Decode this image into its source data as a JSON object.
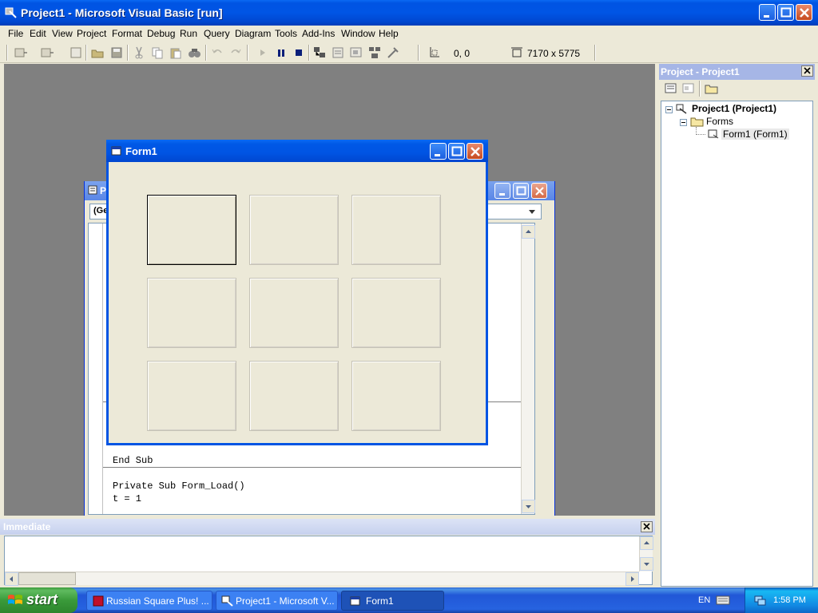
{
  "window": {
    "title": "Project1 - Microsoft Visual Basic [run]"
  },
  "menu": [
    "File",
    "Edit",
    "View",
    "Project",
    "Format",
    "Debug",
    "Run",
    "Query",
    "Diagram",
    "Tools",
    "Add-Ins",
    "Window",
    "Help"
  ],
  "toolbar": {
    "position": "0, 0",
    "size": "7170 x 5775"
  },
  "code_window": {
    "combo": "(Ge",
    "lines": [
      "End Sub",
      "Private Sub Form_Load()",
      "t = 1"
    ]
  },
  "form1": {
    "title": "Form1",
    "tiles": 9
  },
  "immediate": {
    "title": "Immediate"
  },
  "project": {
    "title": "Project - Project1",
    "root": "Project1 (Project1)",
    "folder": "Forms",
    "item": "Form1 (Form1)"
  },
  "taskbar": {
    "start": "start",
    "tasks": [
      "Russian Square Plus! ...",
      "Project1 - Microsoft V...",
      "Form1"
    ],
    "lang": "EN",
    "clock": "1:58 PM"
  }
}
